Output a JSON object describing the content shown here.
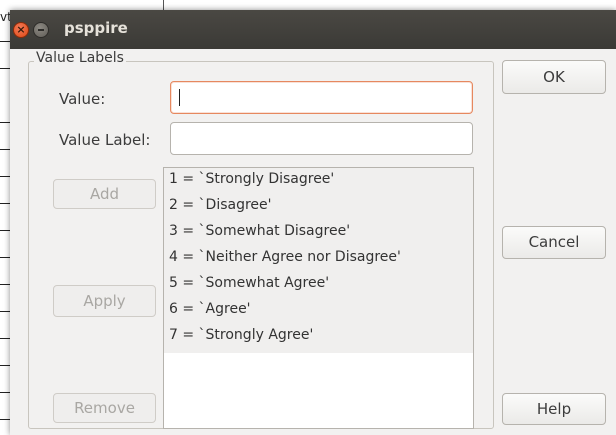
{
  "background": {
    "fragment": "vt"
  },
  "window": {
    "title": "psppire",
    "close_glyph": "×"
  },
  "frame": {
    "label": "Value Labels"
  },
  "form": {
    "value_label": "Value:",
    "value_input": "",
    "value_label_label": "Value Label:",
    "value_label_input": ""
  },
  "buttons": {
    "add": "Add",
    "apply": "Apply",
    "remove": "Remove",
    "ok": "OK",
    "cancel": "Cancel",
    "help": "Help"
  },
  "list": {
    "items": [
      "1 = `Strongly Disagree'",
      "2 = `Disagree'",
      "3 = `Somewhat Disagree'",
      "4 = `Neither Agree nor Disagree'",
      "5 = `Somewhat Agree'",
      "6 = `Agree'",
      "7 = `Strongly Agree'"
    ]
  },
  "colors": {
    "titlebar": "#3b3a36",
    "close_button": "#dd4814",
    "focus_border": "#e6885f",
    "dialog_bg": "#f2f1f0"
  }
}
